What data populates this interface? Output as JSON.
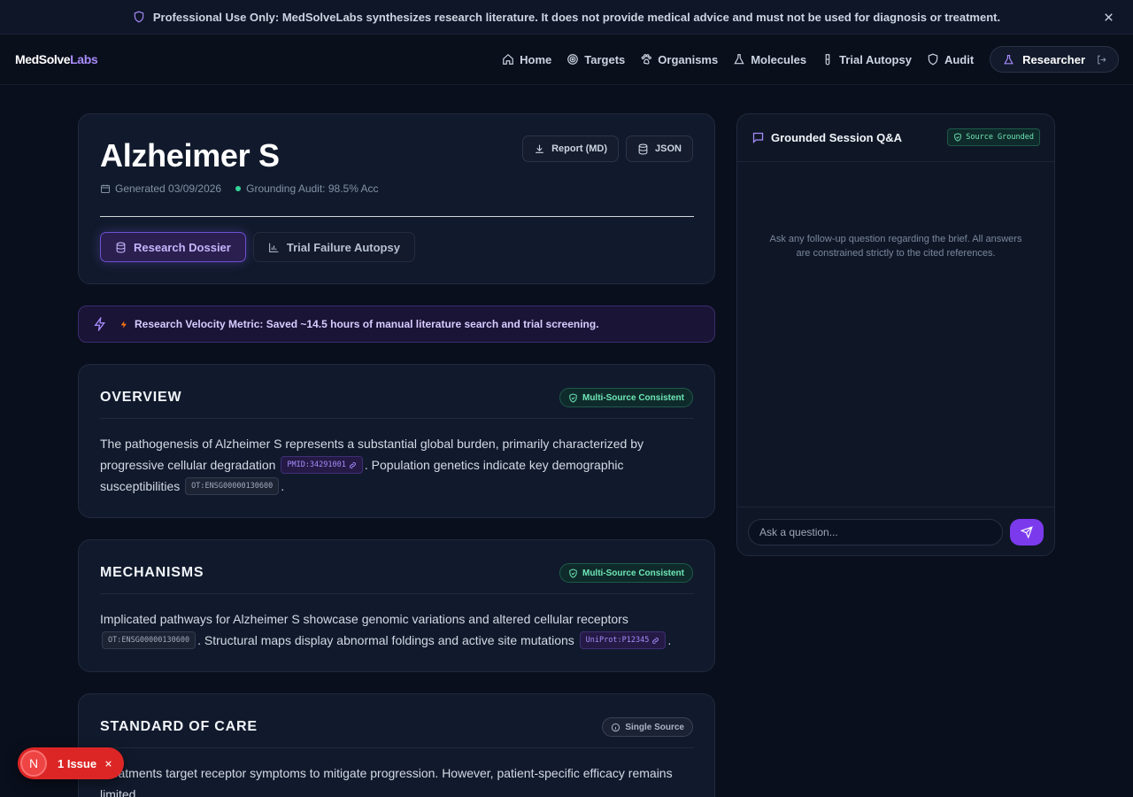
{
  "banner": {
    "text": "Professional Use Only: MedSolveLabs synthesizes research literature. It does not provide medical advice and must not be used for diagnosis or treatment.",
    "icon": "shield-icon",
    "close_icon": "close-icon"
  },
  "nav": {
    "logo_main": "MedSolve",
    "logo_accent": "Labs",
    "links": [
      {
        "label": "Home",
        "icon": "home-icon"
      },
      {
        "label": "Targets",
        "icon": "target-icon"
      },
      {
        "label": "Organisms",
        "icon": "paw-icon"
      },
      {
        "label": "Molecules",
        "icon": "flask-icon"
      },
      {
        "label": "Trial Autopsy",
        "icon": "test-tube-icon"
      },
      {
        "label": "Audit",
        "icon": "shield-icon"
      }
    ],
    "user_role": "Researcher"
  },
  "brief": {
    "title": "Alzheimer S",
    "generated": "Generated 03/09/2026",
    "audit": "Grounding Audit: 98.5% Acc",
    "report_button": "Report (MD)",
    "json_button": "JSON",
    "tabs": [
      {
        "label": "Research Dossier",
        "active": true
      },
      {
        "label": "Trial Failure Autopsy",
        "active": false
      }
    ]
  },
  "velocity": {
    "text": "Research Velocity Metric: Saved ~14.5 hours of manual literature search and trial screening."
  },
  "sections": {
    "overview": {
      "title": "OVERVIEW",
      "badge": "Multi-Source Consistent",
      "text_1": "The pathogenesis of Alzheimer S represents a substantial global burden, primarily characterized by progressive cellular degradation",
      "cite_1": "PMID:34291001",
      "text_2": ". Population genetics indicate key demographic susceptibilities",
      "cite_2": "OT:ENSG00000130600",
      "text_3": "."
    },
    "mechanisms": {
      "title": "MECHANISMS",
      "badge": "Multi-Source Consistent",
      "text_1": "Implicated pathways for Alzheimer S showcase genomic variations and altered cellular receptors",
      "cite_1": "OT:ENSG00000130600",
      "text_2": ". Structural maps display abnormal foldings and active site mutations",
      "cite_2": "UniProt:P12345",
      "text_3": "."
    },
    "standard_of_care": {
      "title": "STANDARD OF CARE",
      "badge": "Single Source",
      "text_1": "Treatments target receptor symptoms to mitigate progression. However, patient-specific efficacy remains limited."
    }
  },
  "qa": {
    "title": "Grounded Session Q&A",
    "badge": "Source Grounded",
    "empty_text": "Ask any follow-up question regarding the brief. All answers are constrained strictly to the cited references.",
    "input_placeholder": "Ask a question...",
    "input_value": ""
  },
  "issue_pill": {
    "avatar_letter": "N",
    "label": "1 Issue"
  },
  "colors": {
    "background": "#0a0f1d",
    "card": "#111a2c",
    "accent": "#7c3aed",
    "accent_text": "#a78bfa",
    "success": "#34d399",
    "danger": "#dc2626"
  }
}
